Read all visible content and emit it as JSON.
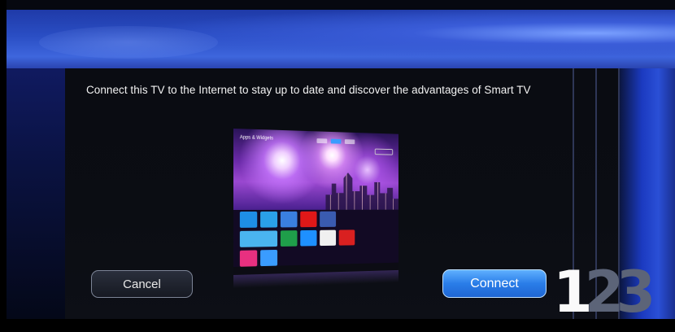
{
  "dialog": {
    "message": "Connect this TV to the Internet to stay up to date and discover the advantages of Smart TV",
    "cancel_label": "Cancel",
    "connect_label": "Connect"
  },
  "steps": {
    "items": [
      "1",
      "2",
      "3"
    ],
    "current": 1
  },
  "illustration": {
    "screen_title": "Apps & Widgets",
    "tiles": [
      "#1e8ee6",
      "#2aa0e8",
      "#3a7fe0",
      "#e01818",
      "#3a5bb0",
      "#4ab4f0",
      "#1f9e4a",
      "#1e90ff",
      "#f0f0f0",
      "#d92020",
      "#e83080",
      "#3a9cff"
    ]
  },
  "colors": {
    "accent_blue": "#2a7de8",
    "background_blue": "#2a4ec4",
    "panel": "#0b0d13"
  }
}
